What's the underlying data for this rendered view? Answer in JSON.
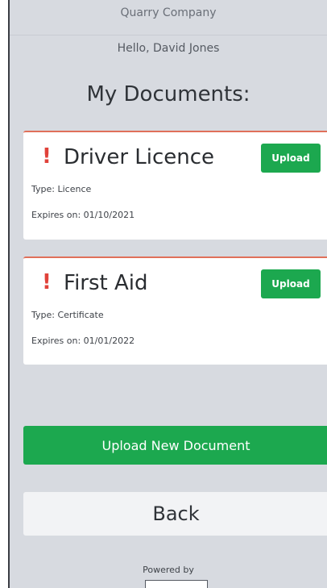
{
  "header": {
    "company": "Quarry Company",
    "greeting": "Hello, David Jones"
  },
  "page": {
    "title": "My Documents:"
  },
  "documents": [
    {
      "alert_icon": "!",
      "name": "Driver Licence",
      "upload_label": "Upload",
      "type_text": "Type: Licence",
      "expires_text": "Expires on: 01/10/2021"
    },
    {
      "alert_icon": "!",
      "name": "First Aid",
      "upload_label": "Upload",
      "type_text": "Type: Certificate",
      "expires_text": "Expires on: 01/01/2022"
    }
  ],
  "actions": {
    "upload_new": "Upload New Document",
    "back": "Back"
  },
  "footer": {
    "powered_by": "Powered by"
  },
  "colors": {
    "background": "#d7dae0",
    "accent_green": "#1ca84f",
    "alert_red": "#e0423a",
    "card_border": "#e0705a"
  }
}
